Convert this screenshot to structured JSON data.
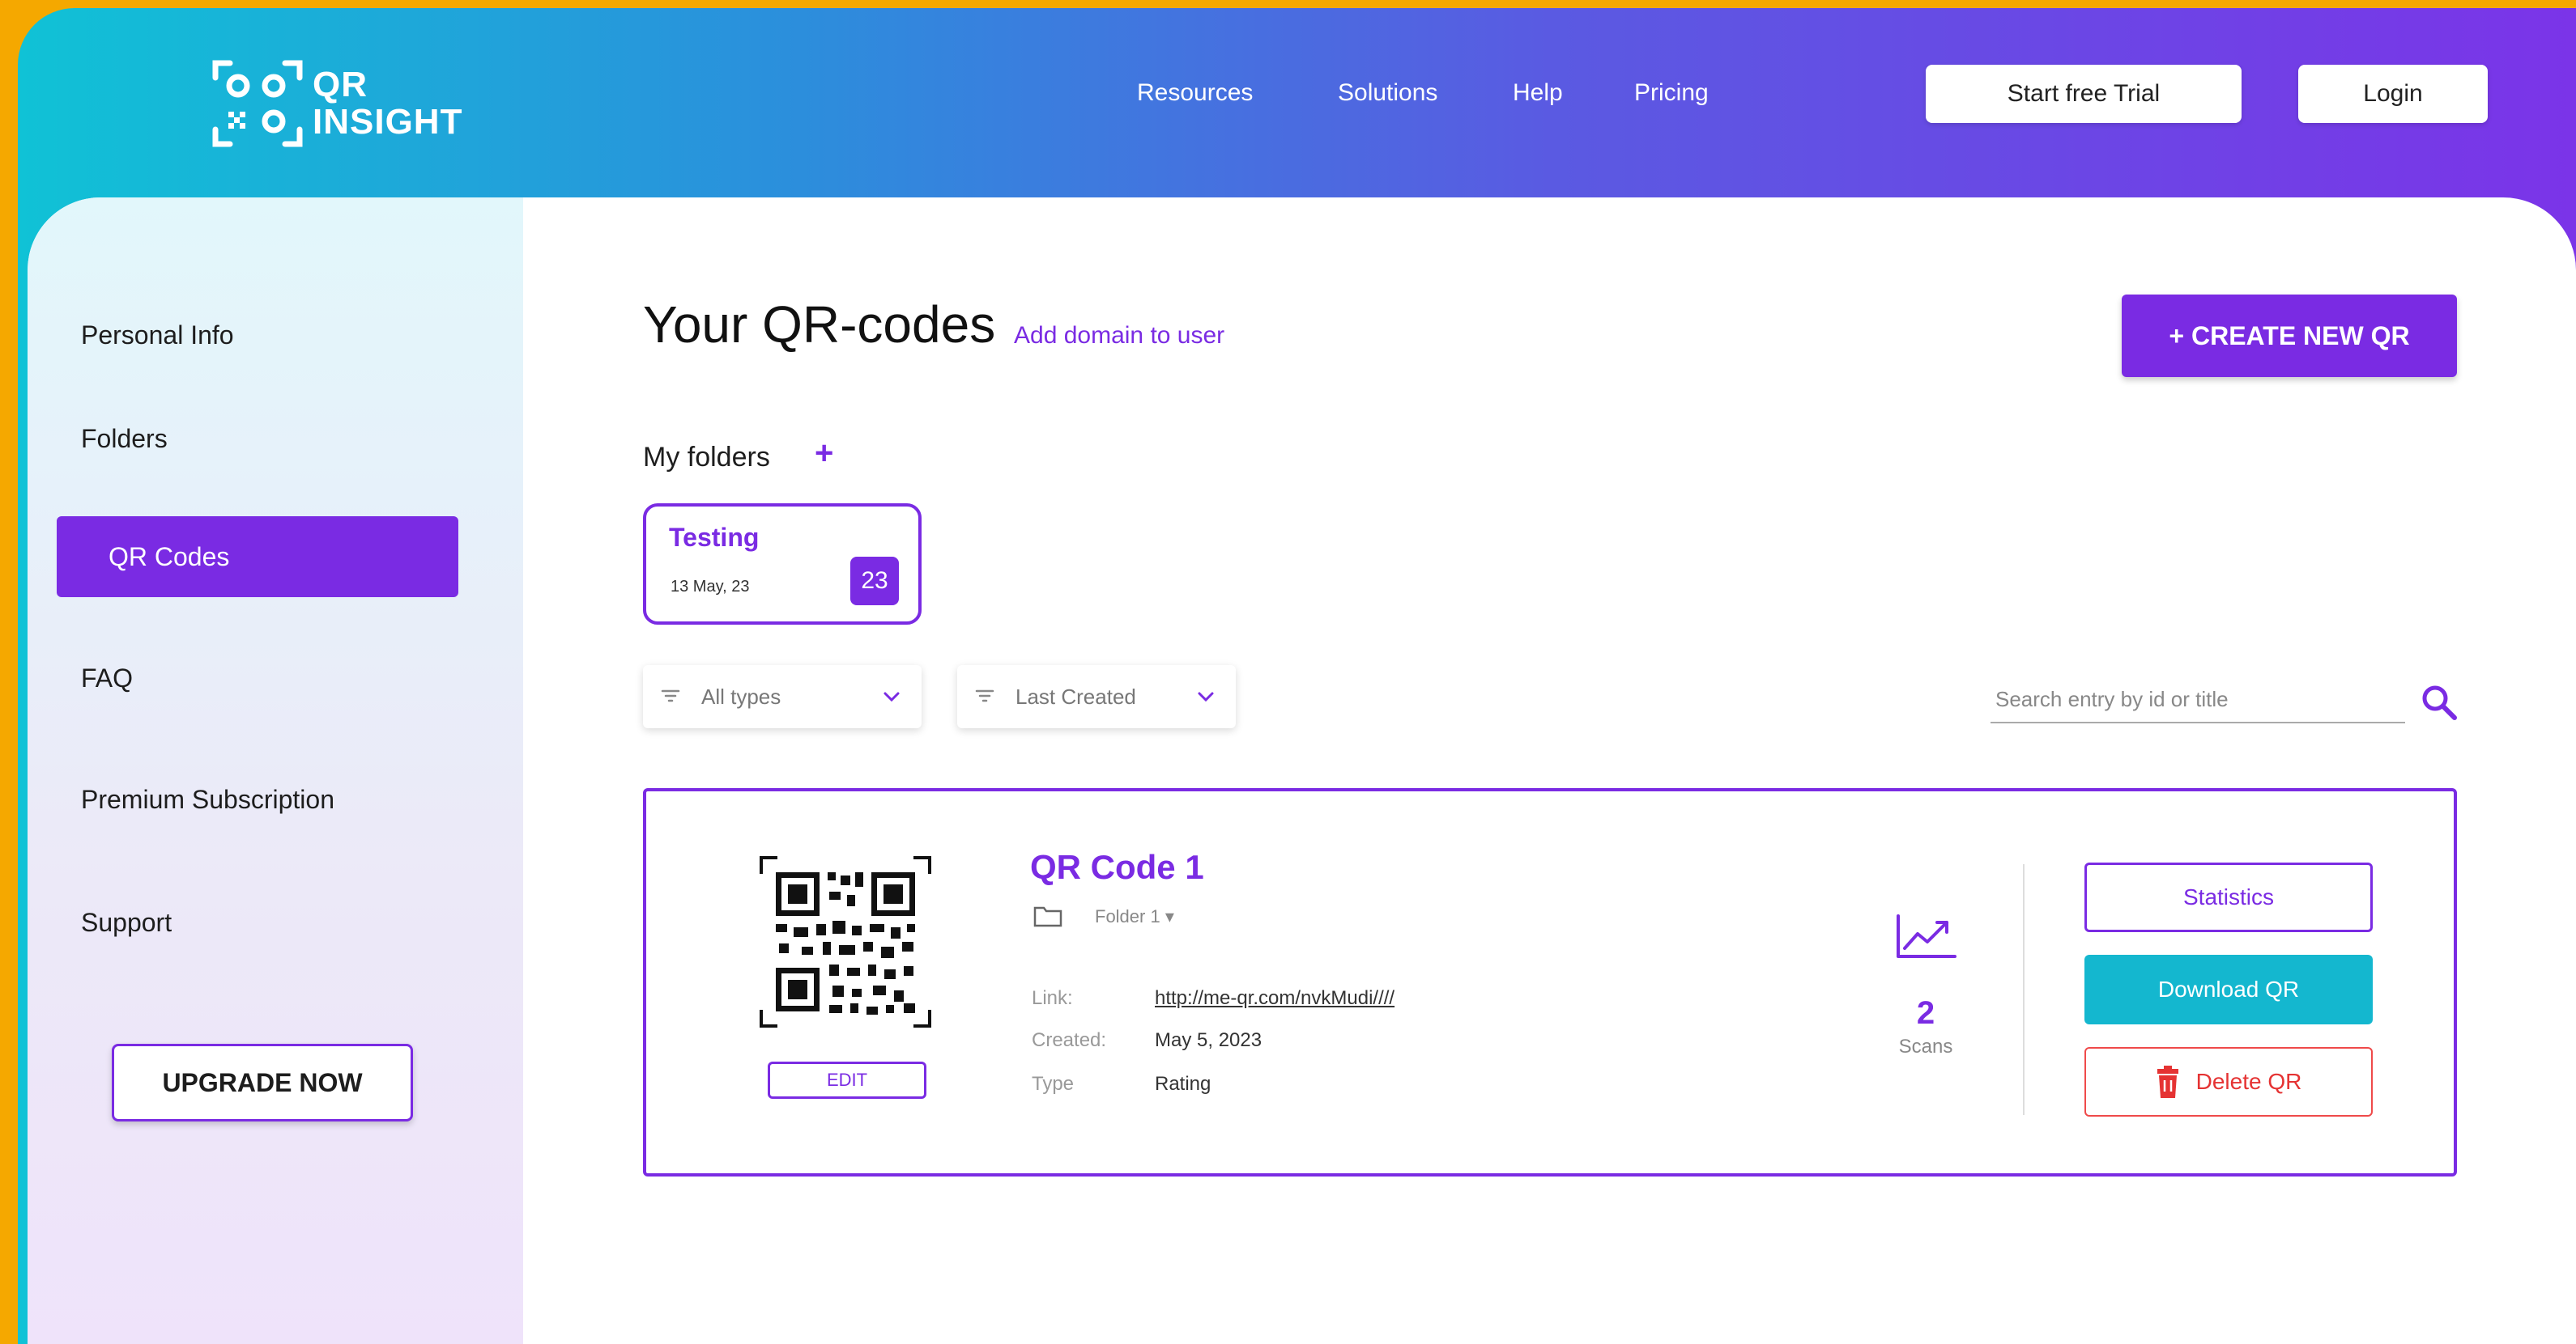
{
  "brand": {
    "logo_text_line1": "QR",
    "logo_text_line2": "INSIGHT"
  },
  "nav": {
    "items": [
      "Resources",
      "Solutions",
      "Help",
      "Pricing"
    ]
  },
  "header_buttons": {
    "trial": "Start free Trial",
    "login": "Login"
  },
  "sidebar": {
    "items": [
      {
        "label": "Personal Info",
        "active": false
      },
      {
        "label": "Folders",
        "active": false
      },
      {
        "label": "QR Codes",
        "active": true
      },
      {
        "label": "FAQ",
        "active": false
      },
      {
        "label": "Premium Subscription",
        "active": false
      },
      {
        "label": "Support",
        "active": false
      }
    ],
    "upgrade_label": "UPGRADE NOW"
  },
  "main": {
    "title": "Your QR-codes",
    "add_domain": "Add domain to user",
    "create_label": "+ CREATE NEW QR",
    "folders_label": "My folders",
    "folders_add": "+",
    "folder": {
      "name": "Testing",
      "date": "13 May, 23",
      "count": "23"
    },
    "filters": {
      "type": "All types",
      "sort": "Last Created"
    },
    "search_placeholder": "Search entry by id or title"
  },
  "qr_card": {
    "name": "QR Code 1",
    "folder": "Folder 1 ▾",
    "edit_label": "EDIT",
    "link_label": "Link:",
    "link_value": "http://me-qr.com/nvkMudi////",
    "created_label": "Created:",
    "created_value": "May 5, 2023",
    "type_label": "Type",
    "type_value": "Rating",
    "scans_count": "2",
    "scans_label": "Scans",
    "statistics_label": "Statistics",
    "download_label": "Download QR",
    "delete_label": "Delete QR"
  },
  "colors": {
    "accent": "#7a2be3",
    "teal": "#14b7cf",
    "danger": "#e53333",
    "frame_yellow": "#f5a800"
  }
}
